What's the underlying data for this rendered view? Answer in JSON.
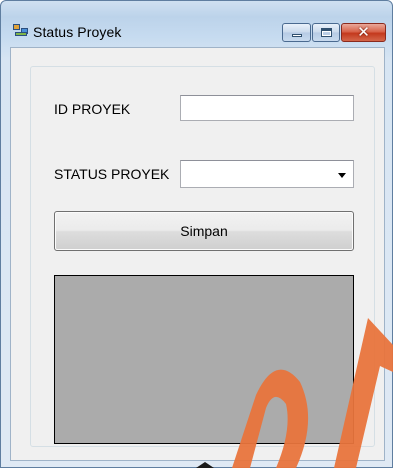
{
  "window": {
    "title": "Status Proyek",
    "icon": "form-app-icon"
  },
  "controls": {
    "minimize_icon": "minimize-icon",
    "maximize_icon": "maximize-icon",
    "close_symbol": "✕"
  },
  "form": {
    "id_label": "ID PROYEK",
    "id_value": "",
    "status_label": "STATUS PROYEK",
    "status_value": "",
    "save_button": "Simpan"
  },
  "colors": {
    "grid_background": "#ababab",
    "watermark": "#e8743c"
  }
}
